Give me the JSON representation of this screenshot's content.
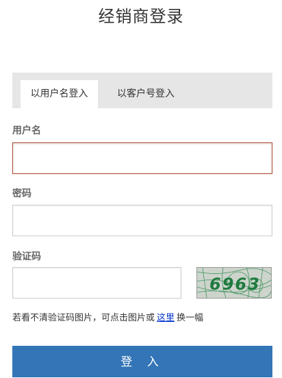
{
  "page": {
    "title": "经销商登录"
  },
  "tabs": [
    {
      "label": "以用户名登入",
      "active": true
    },
    {
      "label": "以客户号登入",
      "active": false
    }
  ],
  "form": {
    "username_label": "用户名",
    "username_value": "",
    "password_label": "密码",
    "password_value": "",
    "captcha_label": "验证码",
    "captcha_value": "",
    "captcha_image_text": "6963"
  },
  "hint": {
    "prefix": "若看不清验证码图片，可点击图片或",
    "link": "这里",
    "suffix": "换一幅"
  },
  "submit": {
    "label": "登 入"
  },
  "colors": {
    "primary_button": "#3375b7",
    "tab_bar": "#e6e6e6",
    "focus_border": "#b4543a",
    "link": "#0033cc",
    "captcha_text": "#1f7a3f"
  }
}
